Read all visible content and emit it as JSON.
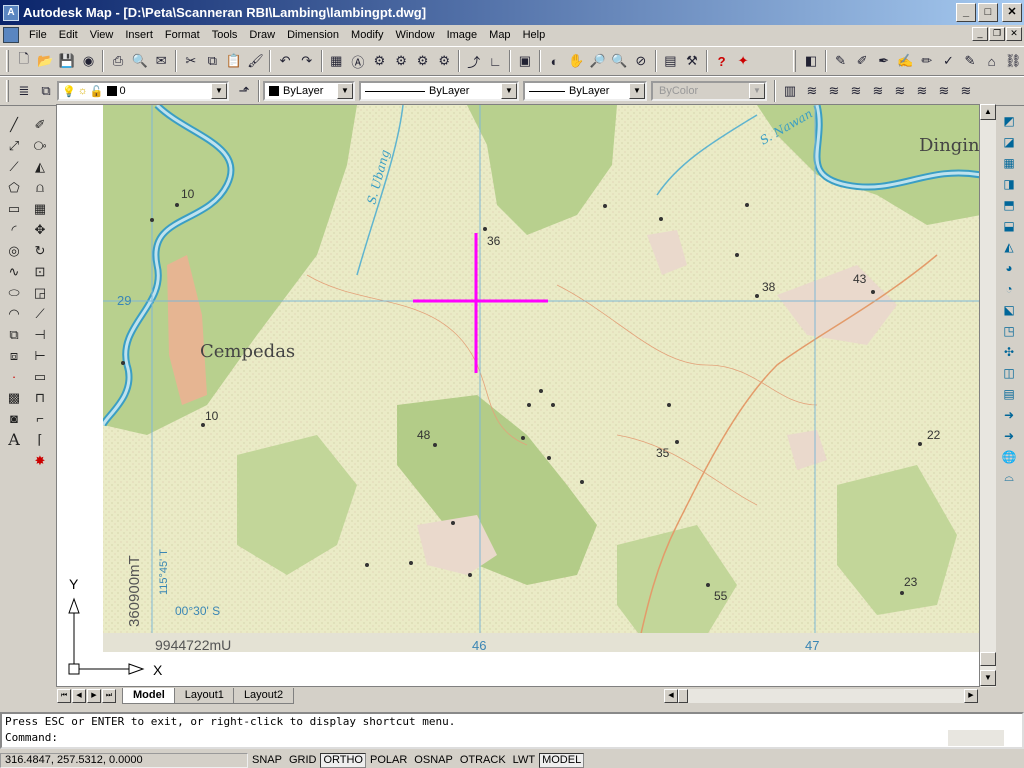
{
  "window": {
    "title": "Autodesk Map - [D:\\Peta\\Scanneran RBI\\Lambing\\lambingpt.dwg]",
    "minimize": "_",
    "maximize": "□",
    "close": "✕"
  },
  "menu": {
    "items": [
      "File",
      "Edit",
      "View",
      "Insert",
      "Format",
      "Tools",
      "Draw",
      "Dimension",
      "Modify",
      "Window",
      "Image",
      "Map",
      "Help"
    ],
    "mdi_min": "_",
    "mdi_restore": "❐",
    "mdi_close": "✕"
  },
  "properties": {
    "layer_value": "0",
    "color_value": "ByLayer",
    "linetype_value": "ByLayer",
    "lineweight_value": "ByLayer",
    "plotstyle_value": "ByColor"
  },
  "map": {
    "place_labels": {
      "cempedas": "Cempedas",
      "dingin": "Dingin",
      "s_ubang": "S. Ubang",
      "s_nawan": "S. Nawan"
    },
    "spot_heights": [
      "10",
      "36",
      "38",
      "43",
      "10",
      "48",
      "35",
      "22",
      "23",
      "55"
    ],
    "grid_labels": {
      "y29": "29",
      "x46": "46",
      "x47": "47",
      "easting": "360900mT",
      "lon": "115°45' T",
      "lat": "00°30' S",
      "northing": "9944722mU"
    },
    "crosshair_color": "#ff00ff"
  },
  "ucs": {
    "x_label": "X",
    "y_label": "Y"
  },
  "layout_tabs": [
    "Model",
    "Layout1",
    "Layout2"
  ],
  "command": {
    "line1": "Press ESC or ENTER to exit, or right-click to display shortcut menu.",
    "line2": "Command:"
  },
  "status": {
    "coordinates": "316.4847, 257.5312, 0.0000",
    "toggles": [
      {
        "label": "SNAP",
        "on": false
      },
      {
        "label": "GRID",
        "on": false
      },
      {
        "label": "ORTHO",
        "on": true
      },
      {
        "label": "POLAR",
        "on": false
      },
      {
        "label": "OSNAP",
        "on": false
      },
      {
        "label": "OTRACK",
        "on": false
      },
      {
        "label": "LWT",
        "on": false
      },
      {
        "label": "MODEL",
        "on": true
      }
    ]
  }
}
